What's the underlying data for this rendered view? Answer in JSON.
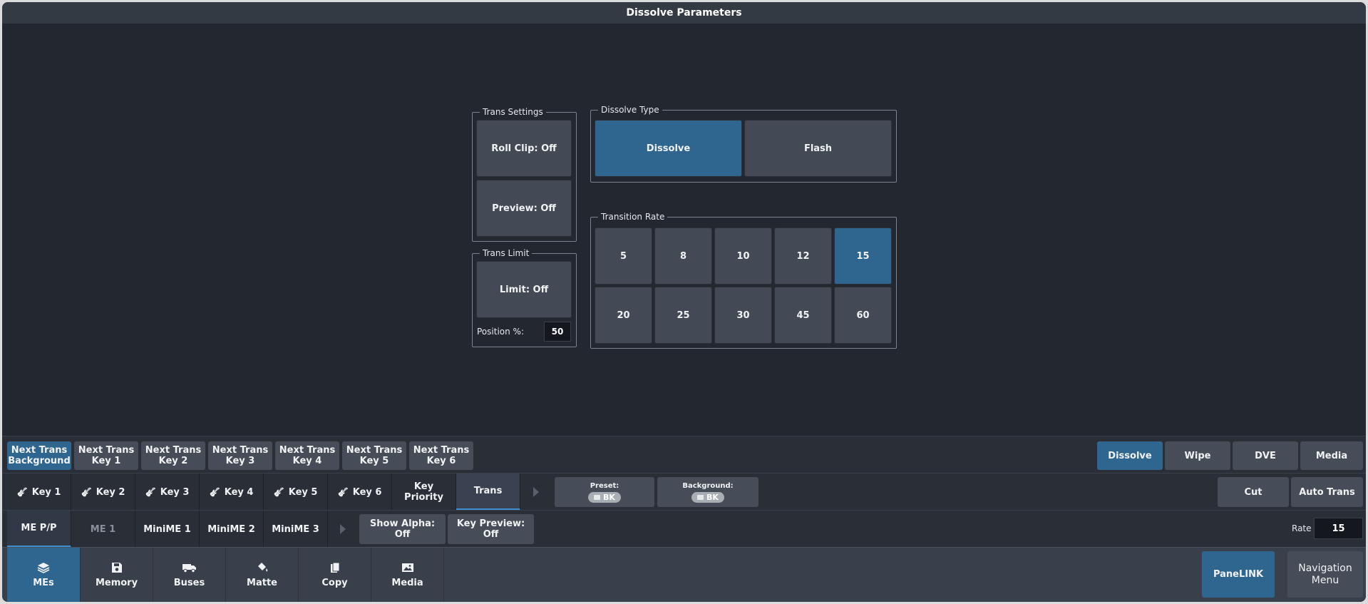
{
  "title": "Dissolve Parameters",
  "trans_settings": {
    "legend": "Trans Settings",
    "roll_clip": "Roll Clip: Off",
    "preview": "Preview: Off"
  },
  "trans_limit": {
    "legend": "Trans Limit",
    "limit": "Limit: Off",
    "position_label": "Position %:",
    "position_value": "50"
  },
  "dissolve_type": {
    "legend": "Dissolve Type",
    "options": [
      "Dissolve",
      "Flash"
    ],
    "selected": "Dissolve"
  },
  "transition_rate": {
    "legend": "Transition Rate",
    "options": [
      "5",
      "8",
      "10",
      "12",
      "15",
      "20",
      "25",
      "30",
      "45",
      "60"
    ],
    "selected": "15"
  },
  "next_trans": [
    {
      "line1": "Next Trans",
      "line2": "Background",
      "selected": true
    },
    {
      "line1": "Next Trans",
      "line2": "Key 1"
    },
    {
      "line1": "Next Trans",
      "line2": "Key 2"
    },
    {
      "line1": "Next Trans",
      "line2": "Key 3"
    },
    {
      "line1": "Next Trans",
      "line2": "Key 4"
    },
    {
      "line1": "Next Trans",
      "line2": "Key 5"
    },
    {
      "line1": "Next Trans",
      "line2": "Key 6"
    }
  ],
  "trans_types": [
    "Dissolve",
    "Wipe",
    "DVE",
    "Media"
  ],
  "trans_type_selected": "Dissolve",
  "key_tabs": [
    "Key 1",
    "Key 2",
    "Key 3",
    "Key 4",
    "Key 5",
    "Key 6"
  ],
  "key_priority": {
    "line1": "Key",
    "line2": "Priority"
  },
  "trans_tab": "Trans",
  "preset": {
    "label": "Preset:",
    "value": "BK"
  },
  "background": {
    "label": "Background:",
    "value": "BK"
  },
  "cut": "Cut",
  "auto_trans": "Auto Trans",
  "me_tabs": [
    "ME P/P",
    "ME 1",
    "MiniME 1",
    "MiniME 2",
    "MiniME 3"
  ],
  "show_alpha": {
    "line1": "Show Alpha:",
    "line2": "Off"
  },
  "key_preview": {
    "line1": "Key Preview:",
    "line2": "Off"
  },
  "rate": {
    "label": "Rate",
    "value": "15"
  },
  "nav_tabs": [
    {
      "label": "MEs",
      "icon": "layers-icon"
    },
    {
      "label": "Memory",
      "icon": "save-icon"
    },
    {
      "label": "Buses",
      "icon": "truck-icon"
    },
    {
      "label": "Matte",
      "icon": "paint-bucket-icon"
    },
    {
      "label": "Copy",
      "icon": "copy-icon"
    },
    {
      "label": "Media",
      "icon": "image-icon"
    }
  ],
  "panelink": "PaneLINK",
  "navigation_menu": {
    "line1": "Navigation",
    "line2": "Menu"
  },
  "colors": {
    "accent": "#2f6690",
    "button": "#444a55",
    "background": "#232830"
  }
}
